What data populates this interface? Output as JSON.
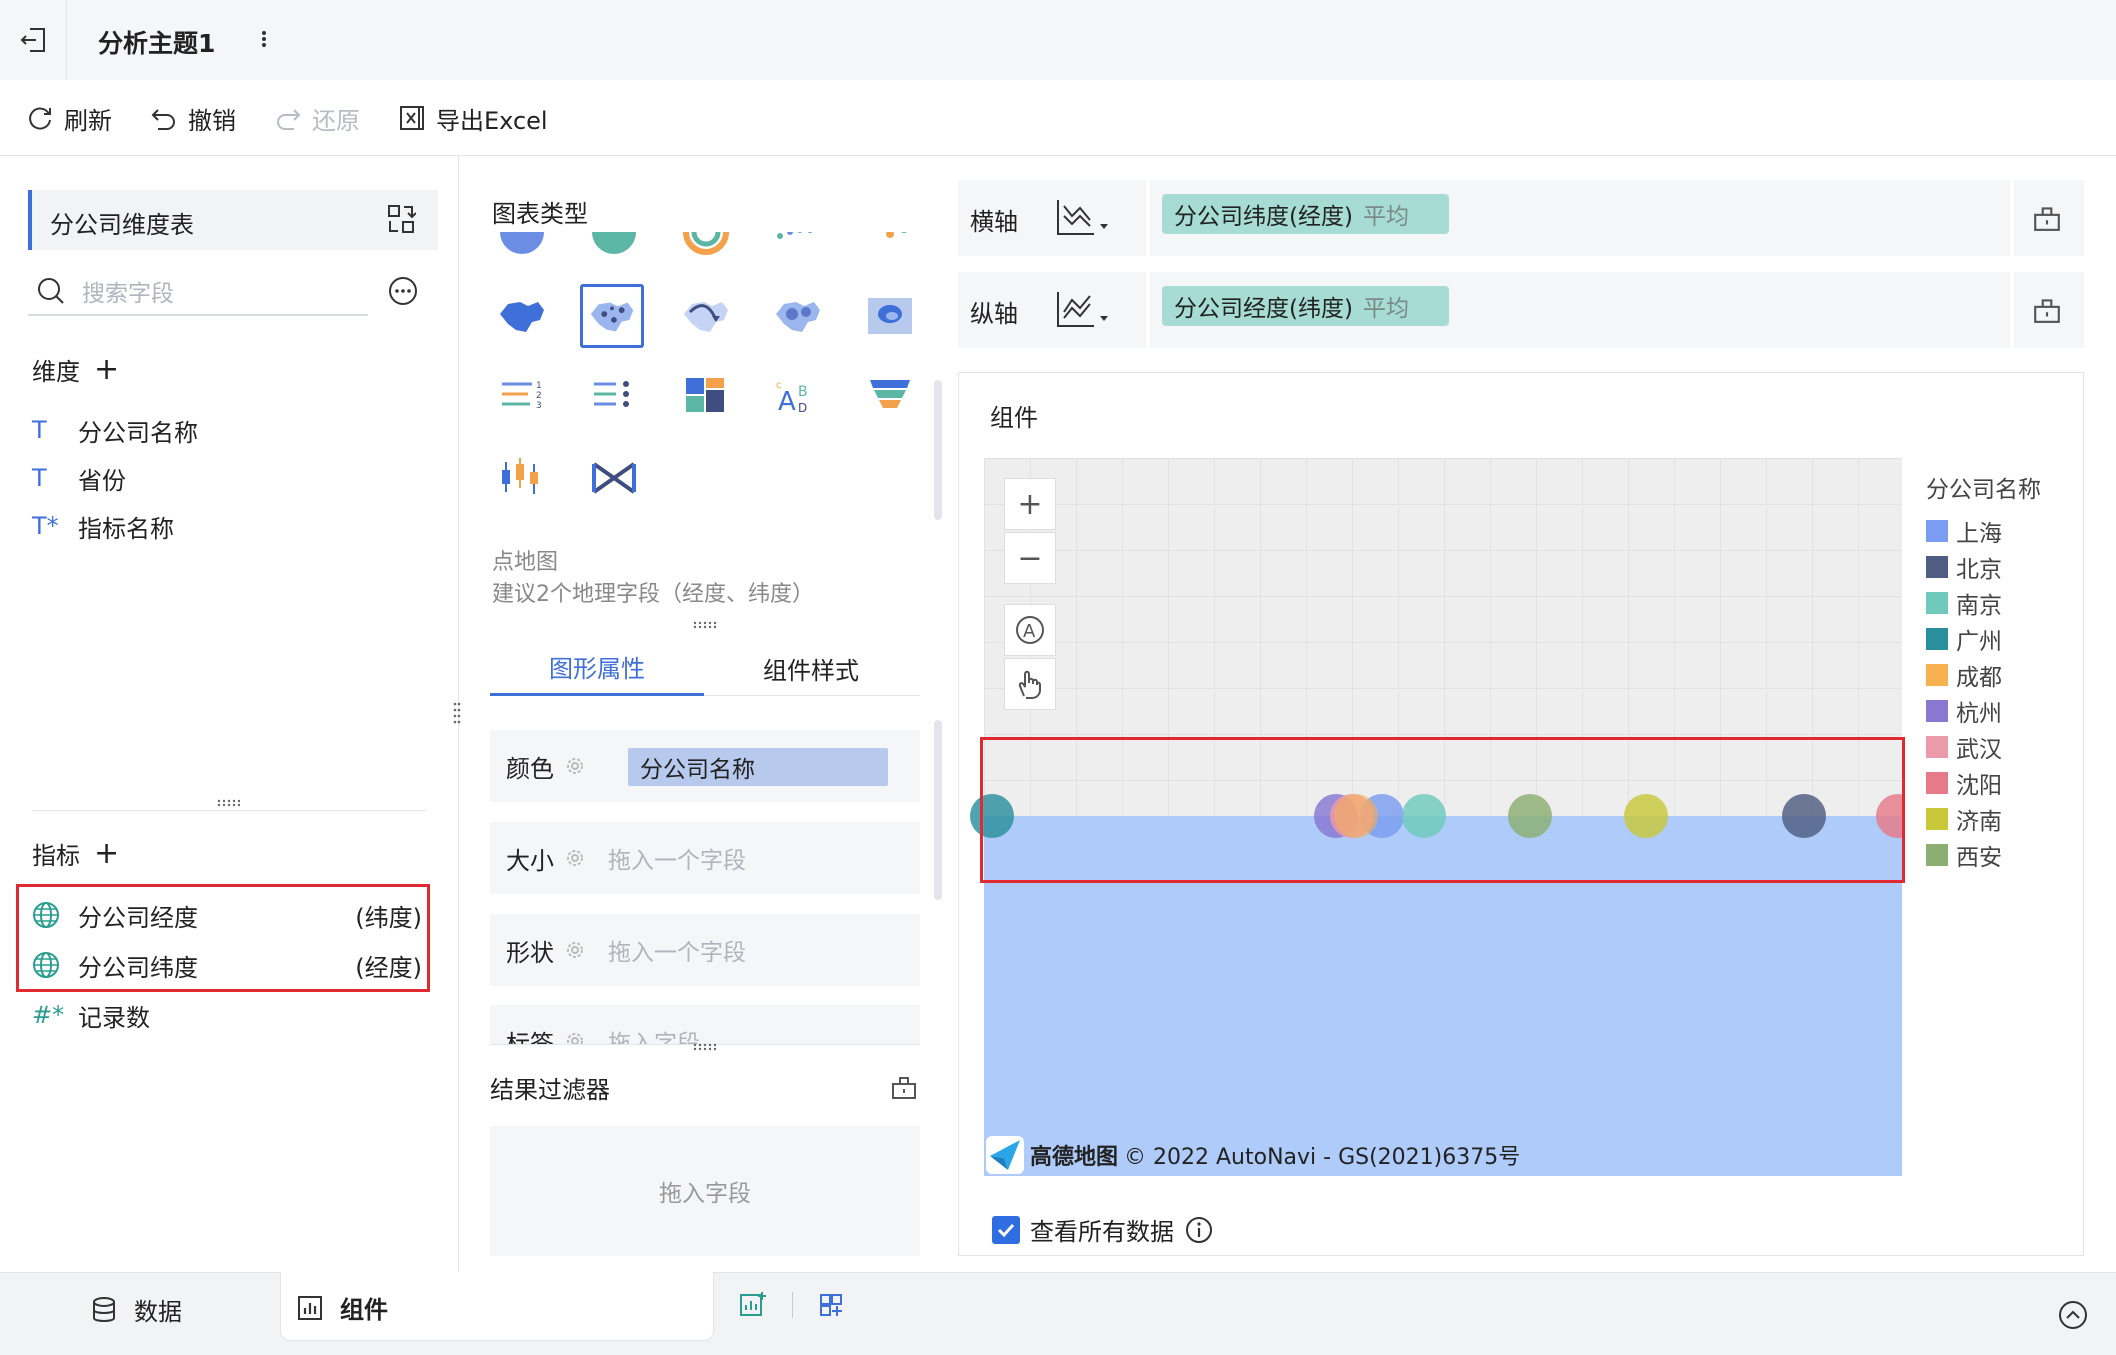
{
  "app": {
    "title": "分析主题1"
  },
  "toolbar": {
    "refresh": "刷新",
    "undo": "撤销",
    "redo": "还原",
    "export": "导出Excel"
  },
  "left": {
    "table_name": "分公司维度表",
    "search_placeholder": "搜索字段",
    "dimension_title": "维度",
    "dimensions": [
      {
        "type_icon": "T",
        "label": "分公司名称"
      },
      {
        "type_icon": "T",
        "label": "省份"
      },
      {
        "type_icon": "T*",
        "label": "指标名称"
      }
    ],
    "metric_title": "指标",
    "metrics": [
      {
        "type_icon": "globe-icon",
        "label": "分公司经度",
        "suffix": "(纬度)"
      },
      {
        "type_icon": "globe-icon",
        "label": "分公司纬度",
        "suffix": "(经度)"
      },
      {
        "type_icon": "#*",
        "label": "记录数",
        "suffix": ""
      }
    ]
  },
  "middle": {
    "chart_type_title": "图表类型",
    "selected_chart": "点地图",
    "chart_hint": "建议2个地理字段（经度、纬度）",
    "tabs": [
      "图形属性",
      "组件样式"
    ],
    "active_tab": "图形属性",
    "props": [
      {
        "label": "颜色",
        "value": "分公司名称",
        "placeholder": ""
      },
      {
        "label": "大小",
        "value": "",
        "placeholder": "拖入一个字段"
      },
      {
        "label": "形状",
        "value": "",
        "placeholder": "拖入一个字段"
      },
      {
        "label": "标签",
        "value": "",
        "placeholder": "拖入字段"
      }
    ],
    "filter_title": "结果过滤器",
    "filter_placeholder": "拖入字段"
  },
  "right": {
    "x_axis": {
      "label": "横轴",
      "field": "分公司纬度(经度)",
      "agg": "平均"
    },
    "y_axis": {
      "label": "纵轴",
      "field": "分公司经度(纬度)",
      "agg": "平均"
    },
    "component_title": "组件",
    "map_attribution": "© 2022 AutoNavi - GS(2021)6375号",
    "map_brand": "高德地图",
    "legend_title": "分公司名称",
    "legend": [
      {
        "name": "上海",
        "color": "#7b9cf0"
      },
      {
        "name": "北京",
        "color": "#4f5d82"
      },
      {
        "name": "南京",
        "color": "#6fcabc"
      },
      {
        "name": "广州",
        "color": "#2a8f9d"
      },
      {
        "name": "成都",
        "color": "#f7b14f"
      },
      {
        "name": "杭州",
        "color": "#8878d2"
      },
      {
        "name": "武汉",
        "color": "#eb9aaa"
      },
      {
        "name": "沈阳",
        "color": "#e67a8a"
      },
      {
        "name": "济南",
        "color": "#c8c83a"
      },
      {
        "name": "西安",
        "color": "#8cae72"
      }
    ],
    "view_all": "查看所有数据",
    "view_all_checked": true
  },
  "bottom": {
    "tab_data": "数据",
    "tab_component": "组件"
  }
}
